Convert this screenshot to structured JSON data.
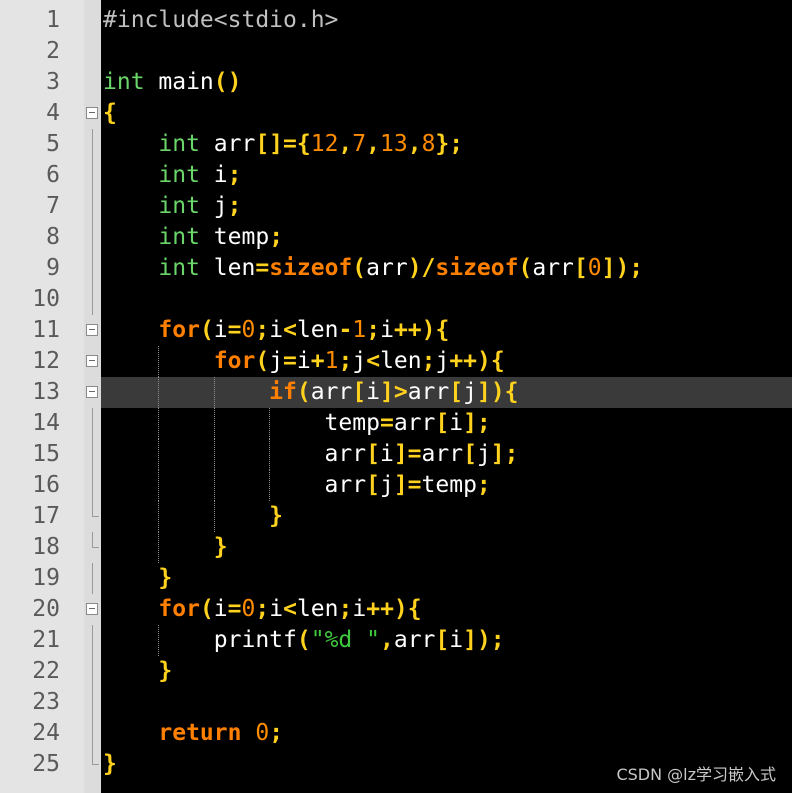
{
  "editor": {
    "current_line": 13,
    "line_numbers": [
      "1",
      "2",
      "3",
      "4",
      "5",
      "6",
      "7",
      "8",
      "9",
      "10",
      "11",
      "12",
      "13",
      "14",
      "15",
      "16",
      "17",
      "18",
      "19",
      "20",
      "21",
      "22",
      "23",
      "24",
      "25"
    ],
    "lines": [
      [
        [
          "pre",
          "#include<stdio.h>"
        ]
      ],
      [],
      [
        [
          "type",
          "int"
        ],
        [
          "id",
          " main"
        ],
        [
          "op",
          "()"
        ]
      ],
      [
        [
          "op",
          "{"
        ]
      ],
      [
        [
          "id",
          "    "
        ],
        [
          "type",
          "int"
        ],
        [
          "id",
          " arr"
        ],
        [
          "op",
          "[]={"
        ],
        [
          "num",
          "12"
        ],
        [
          "op",
          ","
        ],
        [
          "num",
          "7"
        ],
        [
          "op",
          ","
        ],
        [
          "num",
          "13"
        ],
        [
          "op",
          ","
        ],
        [
          "num",
          "8"
        ],
        [
          "op",
          "};"
        ]
      ],
      [
        [
          "id",
          "    "
        ],
        [
          "type",
          "int"
        ],
        [
          "id",
          " i"
        ],
        [
          "op",
          ";"
        ]
      ],
      [
        [
          "id",
          "    "
        ],
        [
          "type",
          "int"
        ],
        [
          "id",
          " j"
        ],
        [
          "op",
          ";"
        ]
      ],
      [
        [
          "id",
          "    "
        ],
        [
          "type",
          "int"
        ],
        [
          "id",
          " temp"
        ],
        [
          "op",
          ";"
        ]
      ],
      [
        [
          "id",
          "    "
        ],
        [
          "type",
          "int"
        ],
        [
          "id",
          " len"
        ],
        [
          "op",
          "="
        ],
        [
          "kw",
          "sizeof"
        ],
        [
          "op",
          "("
        ],
        [
          "id",
          "arr"
        ],
        [
          "op",
          ")/"
        ],
        [
          "kw",
          "sizeof"
        ],
        [
          "op",
          "("
        ],
        [
          "id",
          "arr"
        ],
        [
          "op",
          "["
        ],
        [
          "num",
          "0"
        ],
        [
          "op",
          "]);"
        ]
      ],
      [],
      [
        [
          "id",
          "    "
        ],
        [
          "kw",
          "for"
        ],
        [
          "op",
          "("
        ],
        [
          "id",
          "i"
        ],
        [
          "op",
          "="
        ],
        [
          "num",
          "0"
        ],
        [
          "op",
          ";"
        ],
        [
          "id",
          "i"
        ],
        [
          "op",
          "<"
        ],
        [
          "id",
          "len"
        ],
        [
          "op",
          "-"
        ],
        [
          "num",
          "1"
        ],
        [
          "op",
          ";"
        ],
        [
          "id",
          "i"
        ],
        [
          "op",
          "++){"
        ]
      ],
      [
        [
          "id",
          "        "
        ],
        [
          "kw",
          "for"
        ],
        [
          "op",
          "("
        ],
        [
          "id",
          "j"
        ],
        [
          "op",
          "="
        ],
        [
          "id",
          "i"
        ],
        [
          "op",
          "+"
        ],
        [
          "num",
          "1"
        ],
        [
          "op",
          ";"
        ],
        [
          "id",
          "j"
        ],
        [
          "op",
          "<"
        ],
        [
          "id",
          "len"
        ],
        [
          "op",
          ";"
        ],
        [
          "id",
          "j"
        ],
        [
          "op",
          "++){"
        ]
      ],
      [
        [
          "id",
          "            "
        ],
        [
          "kw",
          "if"
        ],
        [
          "op",
          "("
        ],
        [
          "id",
          "arr"
        ],
        [
          "op",
          "["
        ],
        [
          "id",
          "i"
        ],
        [
          "op",
          "]>"
        ],
        [
          "id",
          "arr"
        ],
        [
          "op",
          "["
        ],
        [
          "id",
          "j"
        ],
        [
          "op",
          "]){"
        ]
      ],
      [
        [
          "id",
          "                temp"
        ],
        [
          "op",
          "="
        ],
        [
          "id",
          "arr"
        ],
        [
          "op",
          "["
        ],
        [
          "id",
          "i"
        ],
        [
          "op",
          "];"
        ]
      ],
      [
        [
          "id",
          "                arr"
        ],
        [
          "op",
          "["
        ],
        [
          "id",
          "i"
        ],
        [
          "op",
          "]="
        ],
        [
          "id",
          "arr"
        ],
        [
          "op",
          "["
        ],
        [
          "id",
          "j"
        ],
        [
          "op",
          "];"
        ]
      ],
      [
        [
          "id",
          "                arr"
        ],
        [
          "op",
          "["
        ],
        [
          "id",
          "j"
        ],
        [
          "op",
          "]="
        ],
        [
          "id",
          "temp"
        ],
        [
          "op",
          ";"
        ]
      ],
      [
        [
          "id",
          "            "
        ],
        [
          "op",
          "}"
        ]
      ],
      [
        [
          "id",
          "        "
        ],
        [
          "op",
          "}"
        ]
      ],
      [
        [
          "id",
          "    "
        ],
        [
          "op",
          "}"
        ]
      ],
      [
        [
          "id",
          "    "
        ],
        [
          "kw",
          "for"
        ],
        [
          "op",
          "("
        ],
        [
          "id",
          "i"
        ],
        [
          "op",
          "="
        ],
        [
          "num",
          "0"
        ],
        [
          "op",
          ";"
        ],
        [
          "id",
          "i"
        ],
        [
          "op",
          "<"
        ],
        [
          "id",
          "len"
        ],
        [
          "op",
          ";"
        ],
        [
          "id",
          "i"
        ],
        [
          "op",
          "++){"
        ]
      ],
      [
        [
          "id",
          "        printf"
        ],
        [
          "op",
          "("
        ],
        [
          "str",
          "\"%d \""
        ],
        [
          "op",
          ","
        ],
        [
          "id",
          "arr"
        ],
        [
          "op",
          "["
        ],
        [
          "id",
          "i"
        ],
        [
          "op",
          "]);"
        ]
      ],
      [
        [
          "id",
          "    "
        ],
        [
          "op",
          "}"
        ]
      ],
      [],
      [
        [
          "id",
          "    "
        ],
        [
          "kw",
          "return"
        ],
        [
          "id",
          " "
        ],
        [
          "num",
          "0"
        ],
        [
          "op",
          ";"
        ]
      ],
      [
        [
          "op",
          "}"
        ]
      ]
    ]
  },
  "watermark": "CSDN @lz学习嵌入式"
}
